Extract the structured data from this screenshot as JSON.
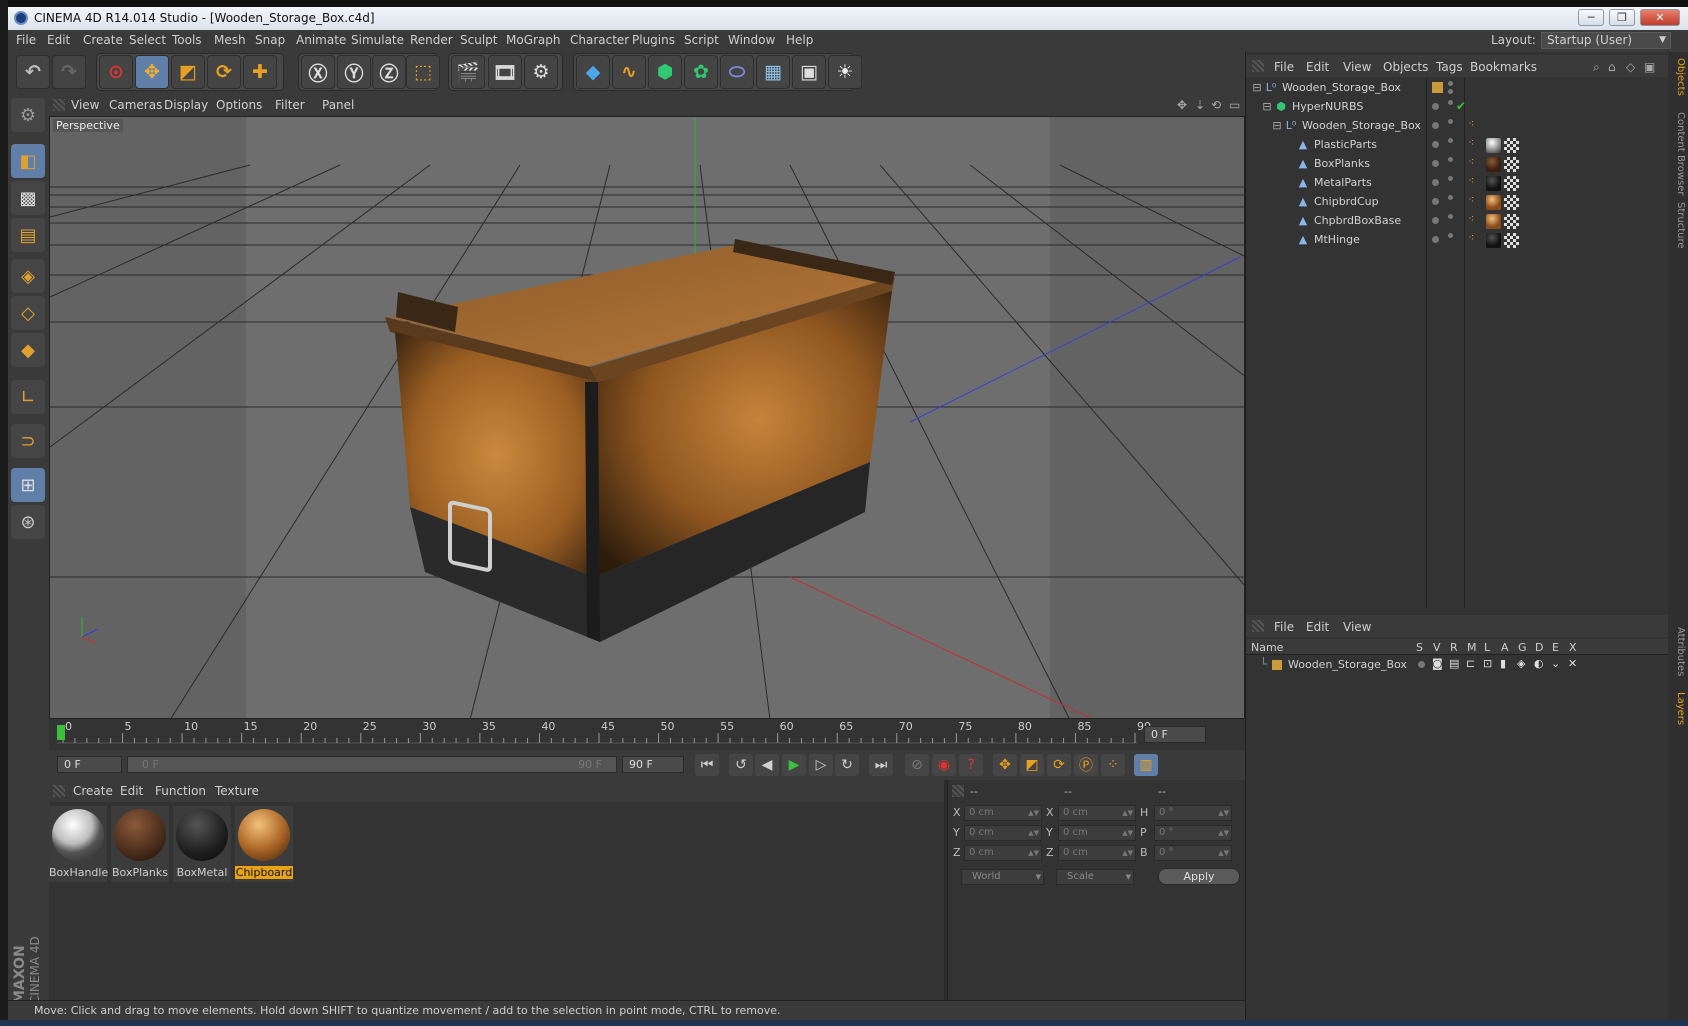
{
  "window": {
    "title": "CINEMA 4D R14.014 Studio - [Wooden_Storage_Box.c4d]",
    "minimize": "─",
    "maximize": "❐",
    "close": "✕"
  },
  "menu": [
    "File",
    "Edit",
    "Create",
    "Select",
    "Tools",
    "Mesh",
    "Snap",
    "Animate",
    "Simulate",
    "Render",
    "Sculpt",
    "MoGraph",
    "Character",
    "Plugins",
    "Script",
    "Window",
    "Help"
  ],
  "layout": {
    "label": "Layout:",
    "value": "Startup (User)"
  },
  "viewport": {
    "menu": [
      "View",
      "Cameras",
      "Display",
      "Options",
      "Filter",
      "Panel"
    ],
    "label": "Perspective"
  },
  "timeline": {
    "ticks": [
      "0",
      "5",
      "10",
      "15",
      "20",
      "25",
      "30",
      "35",
      "40",
      "45",
      "50",
      "55",
      "60",
      "65",
      "70",
      "75",
      "80",
      "85",
      "90"
    ],
    "current_frame": "0 F"
  },
  "playback": {
    "start": "0 F",
    "range_start": "0 F",
    "range_end": "90 F",
    "end": "90 F"
  },
  "materials": {
    "menu": [
      "Create",
      "Edit",
      "Function",
      "Texture"
    ],
    "items": [
      {
        "name": "BoxHandle",
        "selected": false
      },
      {
        "name": "BoxPlanks",
        "selected": false
      },
      {
        "name": "BoxMetal",
        "selected": false
      },
      {
        "name": "Chipboard",
        "selected": true
      }
    ]
  },
  "coords": {
    "headers": [
      "--",
      "--",
      "--"
    ],
    "rows": [
      {
        "a": "X",
        "av": "0 cm",
        "b": "X",
        "bv": "0 cm",
        "c": "H",
        "cv": "0 °"
      },
      {
        "a": "Y",
        "av": "0 cm",
        "b": "Y",
        "bv": "0 cm",
        "c": "P",
        "cv": "0 °"
      },
      {
        "a": "Z",
        "av": "0 cm",
        "b": "Z",
        "bv": "0 cm",
        "c": "B",
        "cv": "0 °"
      }
    ],
    "mode1": "World",
    "mode2": "Scale",
    "apply": "Apply"
  },
  "objects": {
    "menu": [
      "File",
      "Edit",
      "View",
      "Objects",
      "Tags",
      "Bookmarks"
    ],
    "tree": [
      {
        "name": "Wooden_Storage_Box",
        "level": 0,
        "icon": "null-icon"
      },
      {
        "name": "HyperNURBS",
        "level": 1,
        "icon": "hypernurbs-icon"
      },
      {
        "name": "Wooden_Storage_Box",
        "level": 2,
        "icon": "null-icon"
      },
      {
        "name": "PlasticParts",
        "level": 3,
        "icon": "polygon-icon"
      },
      {
        "name": "BoxPlanks",
        "level": 3,
        "icon": "polygon-icon"
      },
      {
        "name": "MetalParts",
        "level": 3,
        "icon": "polygon-icon"
      },
      {
        "name": "ChipbrdCup",
        "level": 3,
        "icon": "polygon-icon"
      },
      {
        "name": "ChpbrdBoxBase",
        "level": 3,
        "icon": "polygon-icon"
      },
      {
        "name": "MtHinge",
        "level": 3,
        "icon": "polygon-icon"
      }
    ]
  },
  "layers": {
    "menu": [
      "File",
      "Edit",
      "View"
    ],
    "columns": [
      "Name",
      "S",
      "V",
      "R",
      "M",
      "L",
      "A",
      "G",
      "D",
      "E",
      "X"
    ],
    "rows": [
      {
        "name": "Wooden_Storage_Box"
      }
    ]
  },
  "side_tabs": [
    "Objects",
    "Content Browser",
    "Structure",
    "Attributes",
    "Layers"
  ],
  "status": "Move: Click and drag to move elements. Hold down SHIFT to quantize movement / add to the selection in point mode, CTRL to remove.",
  "logo": {
    "brand": "MAXON",
    "product": "CINEMA 4D"
  },
  "colors": {
    "accent": "#5f7fa8",
    "selected_material": "#e8a317",
    "axis_x": "#c83030",
    "axis_y": "#30b030",
    "axis_z": "#3040c8"
  }
}
